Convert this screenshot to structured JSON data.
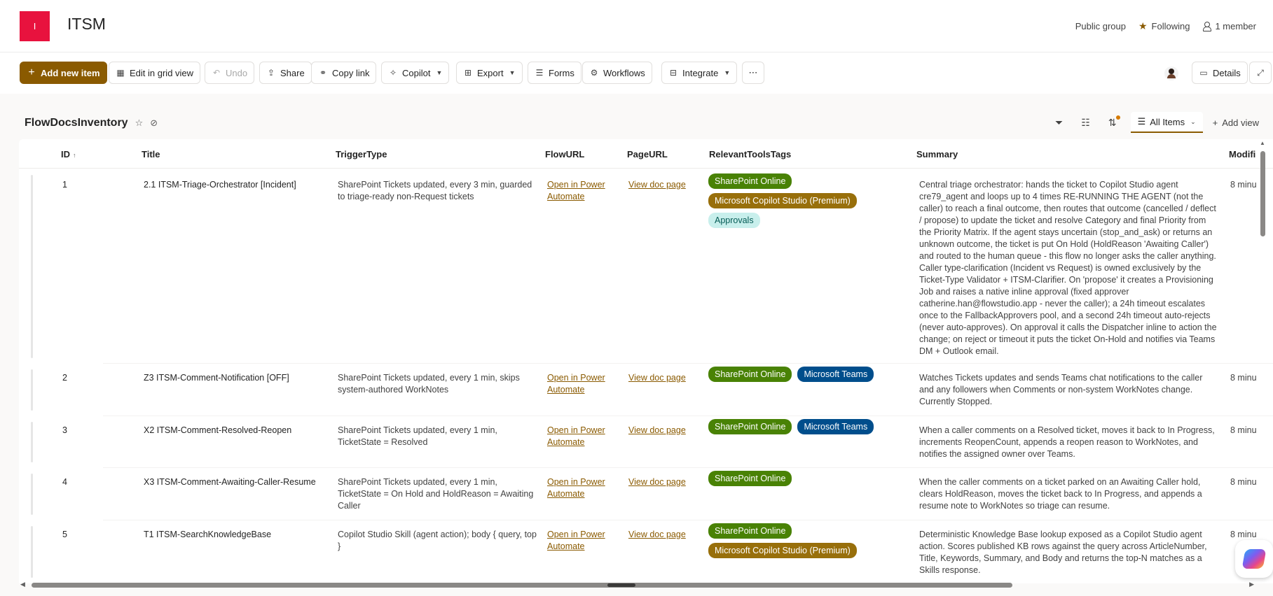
{
  "site": {
    "logo_letter": "I",
    "title": "ITSM",
    "public_group": "Public group",
    "following": "Following",
    "members": "1 member"
  },
  "toolbar": {
    "add_new_item": "Add new item",
    "edit_grid": "Edit in grid view",
    "undo": "Undo",
    "share": "Share",
    "copy_link": "Copy link",
    "copilot": "Copilot",
    "export": "Export",
    "forms": "Forms",
    "workflows": "Workflows",
    "integrate": "Integrate",
    "more": "⋯",
    "details": "Details"
  },
  "list": {
    "title": "FlowDocsInventory",
    "view_name": "All Items",
    "add_view": "Add view"
  },
  "columns": {
    "id": "ID",
    "title": "Title",
    "trigger": "TriggerType",
    "flowurl": "FlowURL",
    "pageurl": "PageURL",
    "tags": "RelevantToolsTags",
    "summary": "Summary",
    "modified": "Modifi"
  },
  "rows": [
    {
      "id": "1",
      "title": "2.1 ITSM-Triage-Orchestrator [Incident]",
      "trigger": "SharePoint Tickets updated, every 3 min, guarded to triage-ready non-Request tickets",
      "flowurl": "Open in Power Automate",
      "pageurl": "View doc page",
      "tags": [
        "SharePoint Online",
        "Microsoft Copilot Studio (Premium)",
        "Approvals"
      ],
      "summary": "Central triage orchestrator: hands the ticket to Copilot Studio agent cre79_agent and loops up to 4 times RE-RUNNING THE AGENT (not the caller) to reach a final outcome, then routes that outcome (cancelled / deflect / propose) to update the ticket and resolve Category and final Priority from the Priority Matrix. If the agent stays uncertain (stop_and_ask) or returns an unknown outcome, the ticket is put On Hold (HoldReason 'Awaiting Caller') and routed to the human queue - this flow no longer asks the caller anything. Caller type-clarification (Incident vs Request) is owned exclusively by the Ticket-Type Validator + ITSM-Clarifier. On 'propose' it creates a Provisioning Job and raises a native inline approval (fixed approver catherine.han@flowstudio.app - never the caller); a 24h timeout escalates once to the FallbackApprovers pool, and a second 24h timeout auto-rejects (never auto-approves). On approval it calls the Dispatcher inline to action the change; on reject or timeout it puts the ticket On-Hold and notifies via Teams DM + Outlook email.",
      "modified": "8 minu"
    },
    {
      "id": "2",
      "title": "Z3 ITSM-Comment-Notification [OFF]",
      "trigger": "SharePoint Tickets updated, every 1 min, skips system-authored WorkNotes",
      "flowurl": "Open in Power Automate",
      "pageurl": "View doc page",
      "tags": [
        "SharePoint Online",
        "Microsoft Teams"
      ],
      "summary": "Watches Tickets updates and sends Teams chat notifications to the caller and any followers when Comments or non-system WorkNotes change. Currently Stopped.",
      "modified": "8 minu"
    },
    {
      "id": "3",
      "title": "X2 ITSM-Comment-Resolved-Reopen",
      "trigger": "SharePoint Tickets updated, every 1 min, TicketState = Resolved",
      "flowurl": "Open in Power Automate",
      "pageurl": "View doc page",
      "tags": [
        "SharePoint Online",
        "Microsoft Teams"
      ],
      "summary": "When a caller comments on a Resolved ticket, moves it back to In Progress, increments ReopenCount, appends a reopen reason to WorkNotes, and notifies the assigned owner over Teams.",
      "modified": "8 minu"
    },
    {
      "id": "4",
      "title": "X3 ITSM-Comment-Awaiting-Caller-Resume",
      "trigger": "SharePoint Tickets updated, every 1 min, TicketState = On Hold and HoldReason = Awaiting Caller",
      "flowurl": "Open in Power Automate",
      "pageurl": "View doc page",
      "tags": [
        "SharePoint Online"
      ],
      "summary": "When the caller comments on a ticket parked on an Awaiting Caller hold, clears HoldReason, moves the ticket back to In Progress, and appends a resume note to WorkNotes so triage can resume.",
      "modified": "8 minu"
    },
    {
      "id": "5",
      "title": "T1 ITSM-SearchKnowledgeBase",
      "trigger": "Copilot Studio Skill (agent action); body { query, top }",
      "flowurl": "Open in Power Automate",
      "pageurl": "View doc page",
      "tags": [
        "SharePoint Online",
        "Microsoft Copilot Studio (Premium)"
      ],
      "summary": "Deterministic Knowledge Base lookup exposed as a Copilot Studio agent action. Scores published KB rows against the query across ArticleNumber, Title, Keywords, Summary, and Body and returns the top-N matches as a Skills response.",
      "modified": "8 minu"
    }
  ],
  "colors": {
    "brand": "#8a5a00",
    "site_logo": "#e8123e",
    "tag_sharepoint": "#498205",
    "tag_copilot": "#986f0b",
    "tag_teams": "#004e8c",
    "tag_approvals": "#c8efec"
  }
}
